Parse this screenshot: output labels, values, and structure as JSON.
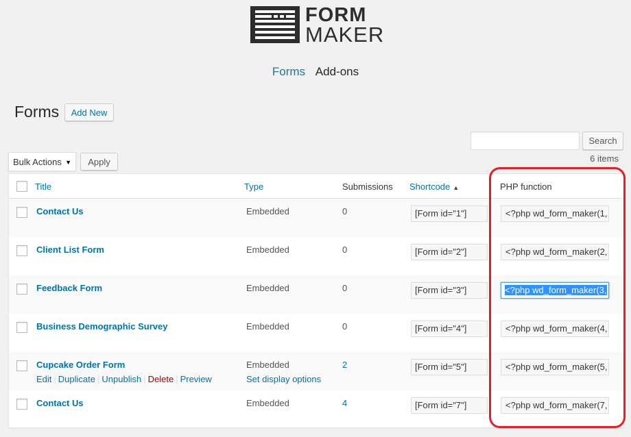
{
  "logo": {
    "word1": "FORM",
    "word2": "MAKER"
  },
  "nav": {
    "forms": "Forms",
    "addons": "Add-ons"
  },
  "page": {
    "title": "Forms",
    "add_new": "Add New"
  },
  "search": {
    "value": "",
    "placeholder": "",
    "button": "Search"
  },
  "items_count": "6 items",
  "bulk": {
    "selected": "Bulk Actions",
    "apply": "Apply"
  },
  "columns": {
    "title": "Title",
    "type": "Type",
    "submissions": "Submissions",
    "shortcode": "Shortcode",
    "php": "PHP function"
  },
  "rows": [
    {
      "title": "Contact Us",
      "type": "Embedded",
      "submissions": "0",
      "shortcode": "[Form id=\"1\"]",
      "php": "<?php wd_form_maker(1,"
    },
    {
      "title": "Client List Form",
      "type": "Embedded",
      "submissions": "0",
      "shortcode": "[Form id=\"2\"]",
      "php": "<?php wd_form_maker(2,"
    },
    {
      "title": "Feedback Form",
      "type": "Embedded",
      "submissions": "0",
      "shortcode": "[Form id=\"3\"]",
      "php": "<?php wd_form_maker(3,"
    },
    {
      "title": "Business Demographic Survey",
      "type": "Embedded",
      "submissions": "0",
      "shortcode": "[Form id=\"4\"]",
      "php": "<?php wd_form_maker(4,"
    },
    {
      "title": "Cupcake Order Form",
      "type": "Embedded",
      "submissions": "2",
      "shortcode": "[Form id=\"5\"]",
      "php": "<?php wd_form_maker(5,",
      "actions": {
        "edit": "Edit",
        "duplicate": "Duplicate",
        "unpublish": "Unpublish",
        "delete": "Delete",
        "preview": "Preview"
      },
      "display_options": "Set display options"
    },
    {
      "title": "Contact Us",
      "type": "Embedded",
      "submissions": "4",
      "shortcode": "[Form id=\"7\"]",
      "php": "<?php wd_form_maker(7,"
    }
  ],
  "colors": {
    "link": "#0073aa",
    "highlight_border": "#e31e24",
    "selection": "#3390ff",
    "delete": "#aa0000"
  },
  "icons": {
    "sort": "triangle-up-icon",
    "dropdown": "caret-down-icon"
  }
}
